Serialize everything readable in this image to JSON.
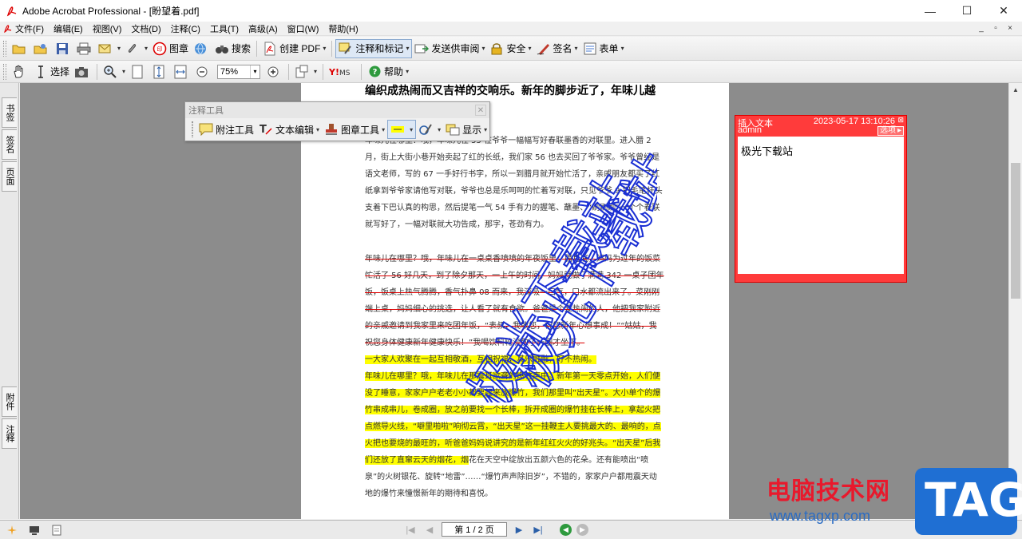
{
  "window": {
    "title": "Adobe Acrobat Professional - [盼望着.pdf]",
    "minimize": "—",
    "maximize": "☐",
    "close": "✕"
  },
  "menu": {
    "items": [
      "文件(F)",
      "编辑(E)",
      "视图(V)",
      "文档(D)",
      "注释(C)",
      "工具(T)",
      "高级(A)",
      "窗口(W)",
      "帮助(H)"
    ]
  },
  "toolbar1": {
    "stamp": "图章",
    "search": "搜索",
    "create_pdf": "创建 PDF",
    "comment_markup": "注释和标记",
    "send_review": "发送供审阅",
    "security": "安全",
    "sign": "签名",
    "forms": "表单"
  },
  "toolbar2": {
    "select": "选择",
    "zoom_value": "75%",
    "help": "帮助"
  },
  "left_tabs": {
    "bookmarks": "书签",
    "signatures": "签名",
    "pages": "页面",
    "attachments": "附件",
    "comments": "注释"
  },
  "comment_toolbar": {
    "title": "注释工具",
    "note_tool": "附注工具",
    "text_edit": "文本编辑",
    "stamp": "图章工具",
    "show": "显示"
  },
  "document": {
    "heading": "编织成热闹而又吉祥的交响乐。新年的脚步近了，年味儿越",
    "p1": "年味儿在哪里？哦，年味儿在 55 在爷爷一幅幅写好春联墨香的对联里。进入腊 2 月，街上大街小巷开始卖起了红的长纸，我们家 56 也去买回了爷爷家。爷爷曾经是语文老师，写的 67 一手好行书字，所以一到腊月就开始忙活了，亲戚朋友都买了红纸拿到爷爷家请他写对联，爷爷也总是乐呵呵的忙着写对联，只见爷爷 9 把毛笔杆头支着下巴认真的构思，然后提笔一气 54 手有力的握笔、蘸墨、“刷刷刷”一个个春联就写好了，一幅对联就大功告成，那字，苍劲有力。",
    "p2": "年味儿在哪里？哦，年味儿在一桌桌香喷喷的年夜饭里。腊月底，妈妈为过年的饭菜忙活了 56 好几天，到了除夕那天，一上午的时间，妈妈就做了满满 342 一桌子团年饭，饭桌上热气腾腾，香气扑鼻 08 而来，我深吸一口气，口水都流出来了。菜刚刚端上桌，妈妈细心的挑选，让人看了就有食欲。爸爸是个爱热闹的人，他把我家附近的亲戚邀请到我家里来吃团年饭，“表叔，我敬您，祝您新年心想事成！”“姑姑，我祝您身体健康新年健康快乐！”我喝饮料轮流敬了一圈才坐下。",
    "p2b": "一大家人欢聚在一起互相敬酒，互相祝福，其乐融融，好不热闹。",
    "p3": "年味儿在哪里？哦，年味儿在那震耳欲聋的爆竹声中。新年第一天零点开始，人们便没了睡意，家家户户老老小小都要起来放爆竹，我们那里叫“出天星”。大小单个的爆竹串成串儿，卷成圈，放之前要找一个长棒，拆开成圈的爆竹挂在长棒上，拿起火把点燃导火线，“噼里啪啦”响彻云霄，“出天星”这一挂鞭主人要挑最大的、最响的，点火把也要烧的最旺的，听爸爸妈妈说讲究的是新年红红火火的好兆头。“出天星”后我们还放了直窜云天的烟花，烟",
    "p3b": "花在天空中绽放出五颜六色的花朵。还有能喷出“喷泉”的火树银花、旋转“地雷”……“爆竹声声除旧岁”，不错的，家家户户都用震天动地的爆竹来憧憬新年的期待和喜悦。"
  },
  "watermark_text": "极光下载站",
  "note": {
    "type": "插入文本",
    "author": "admin",
    "date": "2023-05-17 13:10:26",
    "options": "选项",
    "close": "⊠",
    "body": "极光下载站"
  },
  "status": {
    "page_label": "第 1 / 2 页"
  },
  "site_watermark": {
    "cn": "电脑技术网",
    "url": "www.tagxp.com",
    "tag": "TAG"
  },
  "colors": {
    "note_red": "#ff3b3b",
    "highlight": "#ffff00",
    "watermark_blue": "#1a2fd4"
  }
}
